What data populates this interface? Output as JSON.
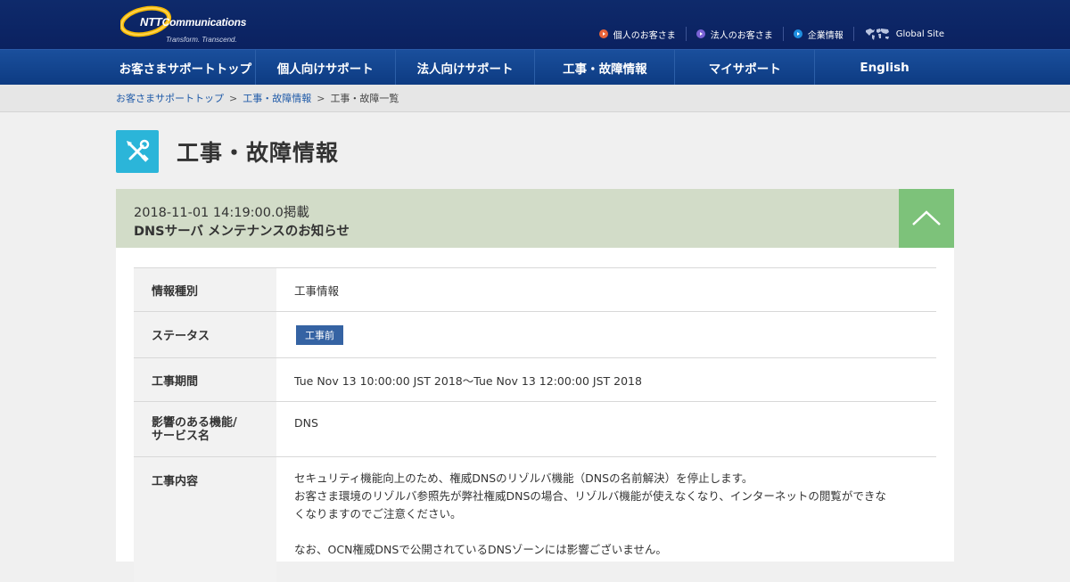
{
  "header": {
    "logo": {
      "name": "NTT Communications",
      "tagline": "Transform. Transcend."
    },
    "util_links": [
      {
        "label": "個人のお客さま",
        "color": "#e8643a"
      },
      {
        "label": "法人のお客さま",
        "color": "#7a62d6"
      },
      {
        "label": "企業情報",
        "color": "#1f8fe0"
      }
    ],
    "global_site": "Global Site"
  },
  "nav": {
    "items": [
      "お客さまサポートトップ",
      "個人向けサポート",
      "法人向けサポート",
      "工事・故障情報",
      "マイサポート",
      "English"
    ]
  },
  "breadcrumb": {
    "items": [
      "お客さまサポートトップ",
      "工事・故障情報"
    ],
    "separator": ">",
    "current": "工事・故障一覧"
  },
  "page": {
    "title": "工事・故障情報",
    "icon": "tools-icon"
  },
  "notice": {
    "posted": "2018-11-01 14:19:00.0掲載",
    "title": "DNSサーバ メンテナンスのお知らせ",
    "rows": {
      "type": {
        "label": "情報種別",
        "value": "工事情報"
      },
      "status": {
        "label": "ステータス",
        "value": "工事前"
      },
      "period": {
        "label": "工事期間",
        "value": "Tue Nov 13 10:00:00 JST 2018〜Tue Nov 13 12:00:00 JST 2018"
      },
      "service": {
        "label_line1": "影響のある機能/",
        "label_line2": "サービス名",
        "value": "DNS"
      },
      "content": {
        "label": "工事内容",
        "line1": "セキュリティ機能向上のため、権威DNSのリゾルバ機能（DNSの名前解決）を停止します。",
        "line2": "お客さま環境のリゾルバ参照先が弊社権威DNSの場合、リゾルバ機能が使えなくなり、インターネットの閲覧ができな",
        "line3": "くなりますのでご注意ください。",
        "line4": "なお、OCN権威DNSで公開されているDNSゾーンには影響ございません。"
      }
    }
  },
  "colors": {
    "header_bg": "#0b2160",
    "nav_bg": "#0d3b82",
    "card_head_bg": "#d2dcc8",
    "collapse_bg": "#7dc27a",
    "status_badge": "#3563a3",
    "title_icon_bg": "#2bb5d9"
  }
}
